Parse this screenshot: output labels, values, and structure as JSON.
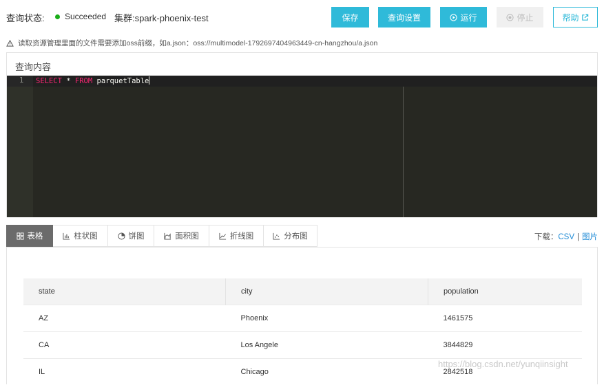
{
  "header": {
    "status_label": "查询状态:",
    "status_text": "Succeeded",
    "status_color": "#1aad19",
    "cluster_label": "集群:spark-phoenix-test",
    "buttons": {
      "save": "保存",
      "query_settings": "查询设置",
      "run": "运行",
      "stop": "停止",
      "help": "帮助"
    }
  },
  "notice": "读取资源管理里面的文件需要添加oss前缀，如a.json：oss://multimodel-1792697404963449-cn-hangzhou/a.json",
  "query": {
    "title": "查询内容",
    "line_number": "1",
    "kw_select": "SELECT",
    "star": " * ",
    "kw_from": "FROM",
    "table": " parquetTable"
  },
  "tabs": [
    "表格",
    "柱状图",
    "饼图",
    "面积图",
    "折线图",
    "分布图"
  ],
  "download": {
    "label": "下载：",
    "csv": "CSV",
    "sep": "|",
    "image": "图片"
  },
  "table": {
    "columns": [
      "state",
      "city",
      "population"
    ],
    "rows": [
      [
        "AZ",
        "Phoenix",
        "1461575"
      ],
      [
        "CA",
        "Los Angele",
        "3844829"
      ],
      [
        "IL",
        "Chicago",
        "2842518"
      ]
    ]
  },
  "watermark": "https://blog.csdn.net/yunqiinsight",
  "colors": {
    "accent": "#2fbad9",
    "editor_bg": "#272822",
    "keyword": "#f92672",
    "link": "#1f8bd6"
  }
}
